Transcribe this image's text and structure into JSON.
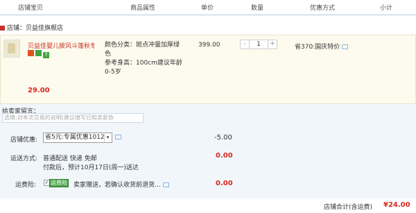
{
  "header": {
    "col_item": "店铺宝贝",
    "col_attr": "商品属性",
    "col_price": "单价",
    "col_qty": "数量",
    "col_promo": "优惠方式",
    "col_subtotal": "小计"
  },
  "shop": {
    "label": "店铺：贝益佳旗舰店"
  },
  "item": {
    "title": "贝益佳婴儿披风斗篷秋冬...",
    "attr_color": "颜色分类：斑点冲量加厚绿色",
    "attr_height": "参考身高：100cm建议年龄0-5岁",
    "price": "399.00",
    "qty": "1",
    "qty_minus": "-",
    "qty_plus": "+",
    "promo": "省370:国庆特价",
    "subtotal": "29.00",
    "badge3": "7"
  },
  "message": {
    "label": "给卖家留言：",
    "placeholder": "选填:对本次交易的说明(建议填写已和卖家协"
  },
  "discount": {
    "label": "店铺优惠:",
    "selected": "省5元:专属优惠1012",
    "amount": "-5.00"
  },
  "shipping": {
    "label": "运送方式:",
    "method": "普通配送 快递 免邮",
    "note": "付款后，预计10月17日(周一)送达",
    "amount": "0.00"
  },
  "insurance": {
    "label": "运费险:",
    "tag": "运费险",
    "text": "卖家赠送，若确认收货前退货...",
    "amount": "0.00"
  },
  "footer": {
    "label": "店铺合计(含运费)",
    "total": "¥24.00"
  },
  "colors": {
    "price_red": "#d9281f",
    "header_border": "#b9c7d6",
    "order_bg": "#f1f6fb",
    "item_bg": "#fdfbee"
  }
}
